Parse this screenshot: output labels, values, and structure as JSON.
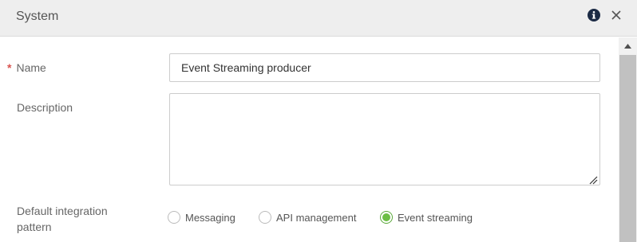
{
  "dialog": {
    "title": "System",
    "info_icon": "info-circle-icon",
    "close_icon": "close-icon"
  },
  "form": {
    "name": {
      "required_marker": "*",
      "label": "Name",
      "value": "Event Streaming producer",
      "placeholder": ""
    },
    "description": {
      "label": "Description",
      "value": "",
      "placeholder": ""
    },
    "integration_pattern": {
      "label": "Default integration pattern",
      "options": [
        "Messaging",
        "API management",
        "Event streaming"
      ],
      "selected": "Event streaming"
    }
  },
  "colors": {
    "header_bg": "#eeeeee",
    "required": "#d9534f",
    "radio_selected": "#6cbe45",
    "info_icon": "#1b2a44"
  }
}
